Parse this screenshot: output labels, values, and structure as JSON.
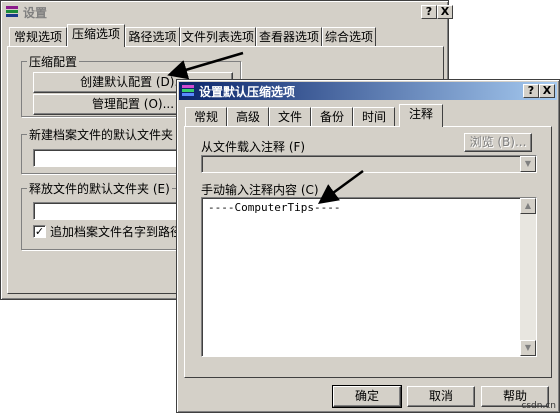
{
  "back_window": {
    "title": "设置",
    "title_buttons": [
      "?",
      "X"
    ],
    "tabs": [
      "常规选项",
      "压缩选项",
      "路径选项",
      "文件列表选项",
      "查看器选项",
      "综合选项"
    ],
    "selected_tab": 1,
    "compress_group": {
      "label": "压缩配置",
      "create_default_button": "创建默认配置 (D)...",
      "manage_button": "管理配置 (O)..."
    },
    "new_archive_group": {
      "label": "新建档案文件的默认文件夹 (F"
    },
    "extract_group": {
      "label": "释放文件的默认文件夹 (E)"
    },
    "append_checkbox": {
      "label": "追加档案文件名字到路径中",
      "checked": true,
      "mark": "✓"
    }
  },
  "front_window": {
    "title": "设置默认压缩选项",
    "title_buttons": [
      "?",
      "X"
    ],
    "tabs": [
      "常规",
      "高级",
      "文件",
      "备份",
      "时间",
      "注释"
    ],
    "selected_tab": 5,
    "load_from_file_label": "从文件载入注释 (F)",
    "browse_button": "浏览 (B)...",
    "manual_input_label": "手动输入注释内容 (C)",
    "comment_text": "----ComputerTips----",
    "ok_button": "确定",
    "cancel_button": "取消",
    "help_button": "帮助"
  },
  "watermark": "csdn.cn",
  "colors": {
    "active_title_start": "#0a246a",
    "active_title_end": "#a6caf0",
    "face": "#d4d0c8"
  }
}
